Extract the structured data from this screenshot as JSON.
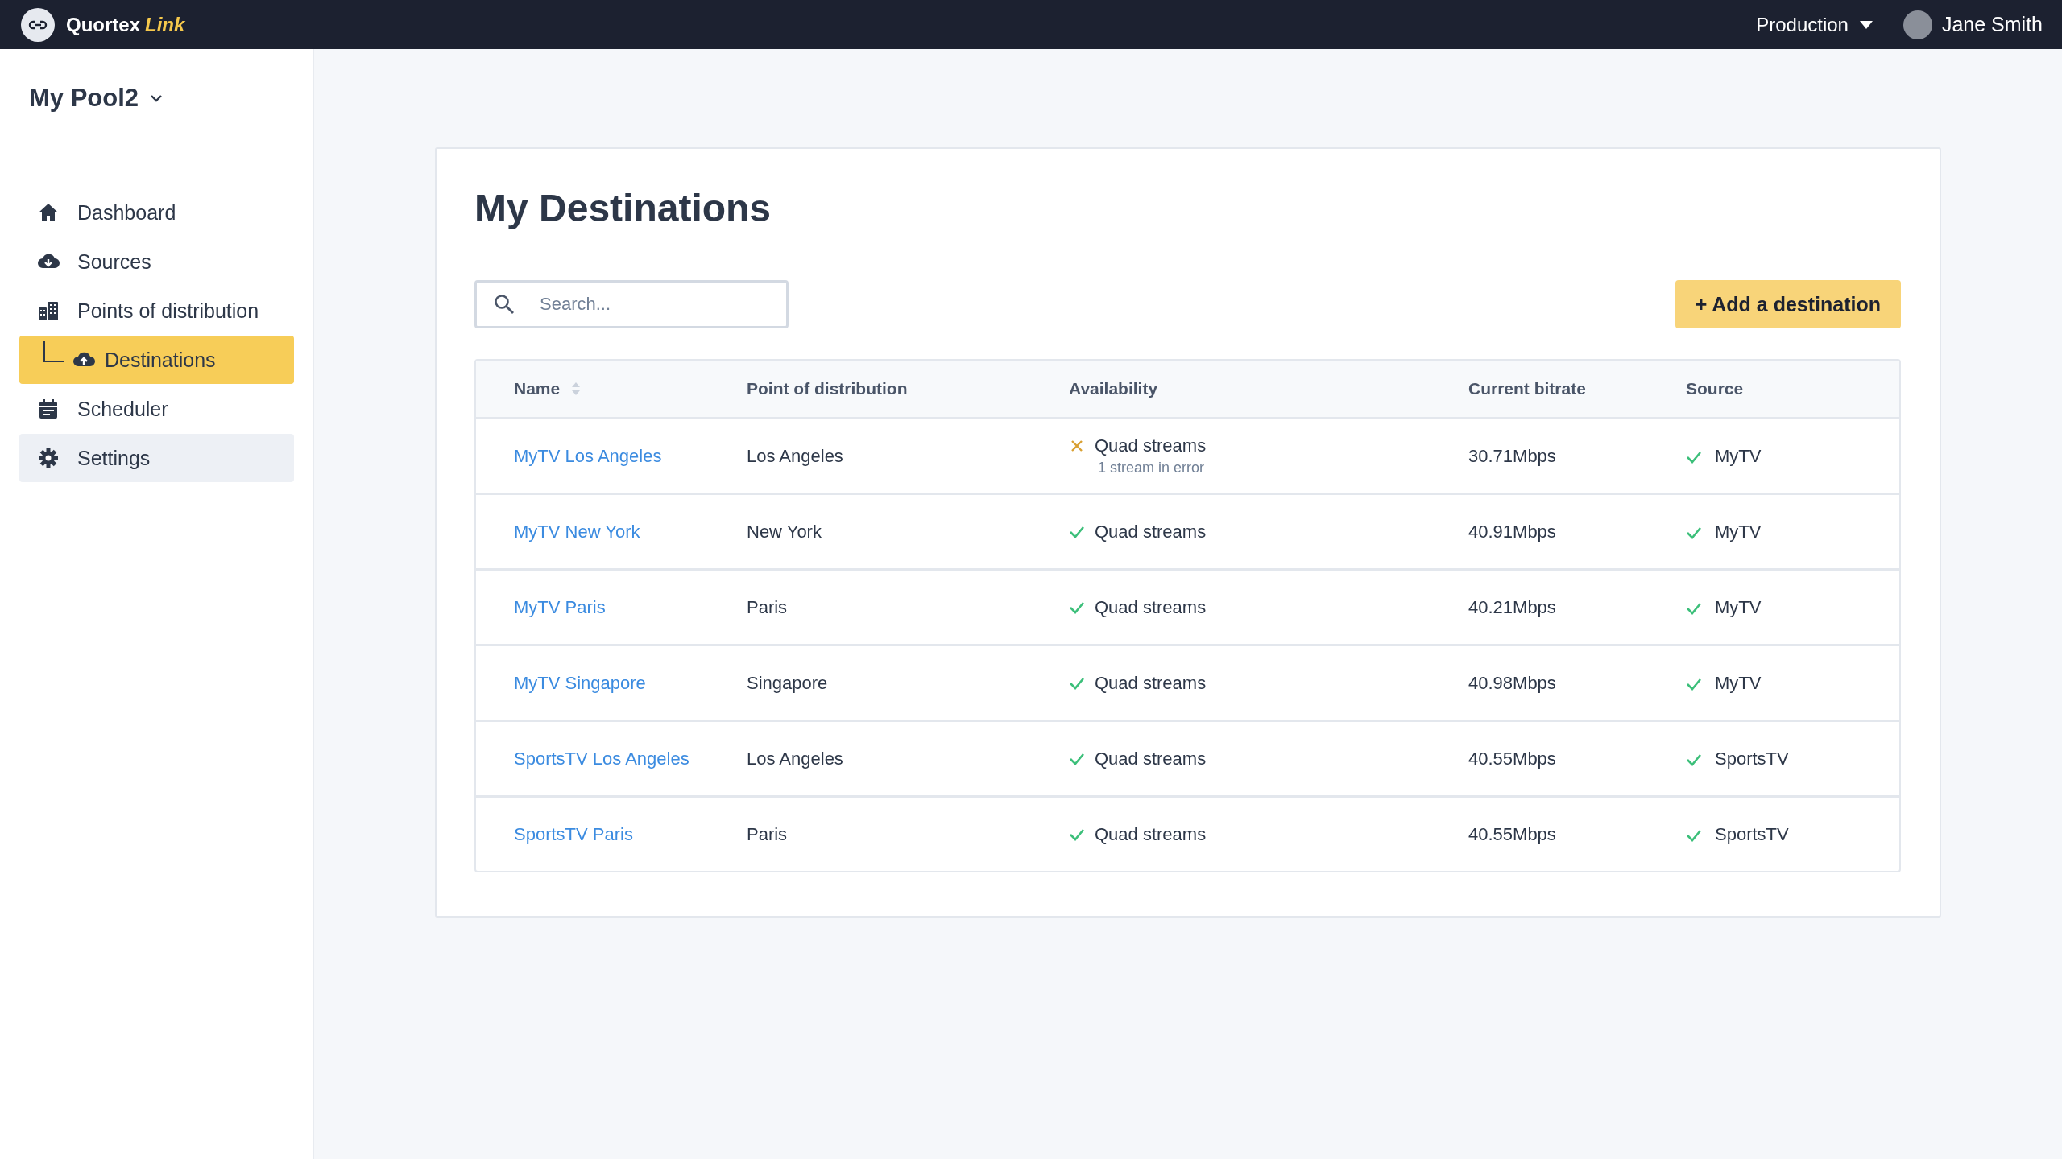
{
  "top_bar": {
    "logo_text": "Quortex",
    "logo_accent": "Link",
    "environment": "Production",
    "user": "Jane Smith"
  },
  "sidebar": {
    "pool": "My Pool2",
    "items": [
      {
        "label": "Dashboard",
        "kind": "home",
        "selected": false,
        "hovered": false
      },
      {
        "label": "Sources",
        "kind": "sources",
        "selected": false,
        "hovered": false
      },
      {
        "label": "Points of distribution",
        "kind": "points",
        "selected": false,
        "hovered": false,
        "children": [
          {
            "label": "Destinations",
            "kind": "destinations",
            "selected": true,
            "hovered": false
          }
        ]
      },
      {
        "label": "Scheduler",
        "kind": "scheduler",
        "selected": false,
        "hovered": false
      },
      {
        "label": "Settings",
        "kind": "settings",
        "selected": false,
        "hovered": true
      }
    ]
  },
  "page": {
    "title": "My Destinations",
    "search": {
      "placeholder": "Search..."
    },
    "add_button": "+ Add a destination"
  },
  "table": {
    "columns": [
      {
        "label": "Name",
        "sortable": true
      },
      {
        "label": "Point of distribution",
        "sortable": false
      },
      {
        "label": "Availability",
        "sortable": false
      },
      {
        "label": "Current bitrate",
        "sortable": false
      },
      {
        "label": "Source",
        "sortable": false
      }
    ],
    "rows": [
      {
        "name": "MyTV Los Angeles",
        "pod": "Los Angeles",
        "availability": {
          "error": true,
          "text": "Quad streams",
          "note": "1 stream in error"
        },
        "bitrate": "30.71Mbps",
        "source": {
          "error": false,
          "text": "MyTV"
        }
      },
      {
        "name": "MyTV New York",
        "pod": "New York",
        "availability": {
          "error": false,
          "text": "Quad streams"
        },
        "bitrate": "40.91Mbps",
        "source": {
          "error": false,
          "text": "MyTV"
        }
      },
      {
        "name": "MyTV Paris",
        "pod": "Paris",
        "availability": {
          "error": false,
          "text": "Quad streams"
        },
        "bitrate": "40.21Mbps",
        "source": {
          "error": false,
          "text": "MyTV"
        }
      },
      {
        "name": "MyTV Singapore",
        "pod": "Singapore",
        "availability": {
          "error": false,
          "text": "Quad streams"
        },
        "bitrate": "40.98Mbps",
        "source": {
          "error": false,
          "text": "MyTV"
        }
      },
      {
        "name": "SportsTV Los Angeles",
        "pod": "Los Angeles",
        "availability": {
          "error": false,
          "text": "Quad streams"
        },
        "bitrate": "40.55Mbps",
        "source": {
          "error": false,
          "text": "SportsTV"
        }
      },
      {
        "name": "SportsTV Paris",
        "pod": "Paris",
        "availability": {
          "error": false,
          "text": "Quad streams"
        },
        "bitrate": "40.55Mbps",
        "source": {
          "error": false,
          "text": "SportsTV"
        }
      }
    ]
  }
}
